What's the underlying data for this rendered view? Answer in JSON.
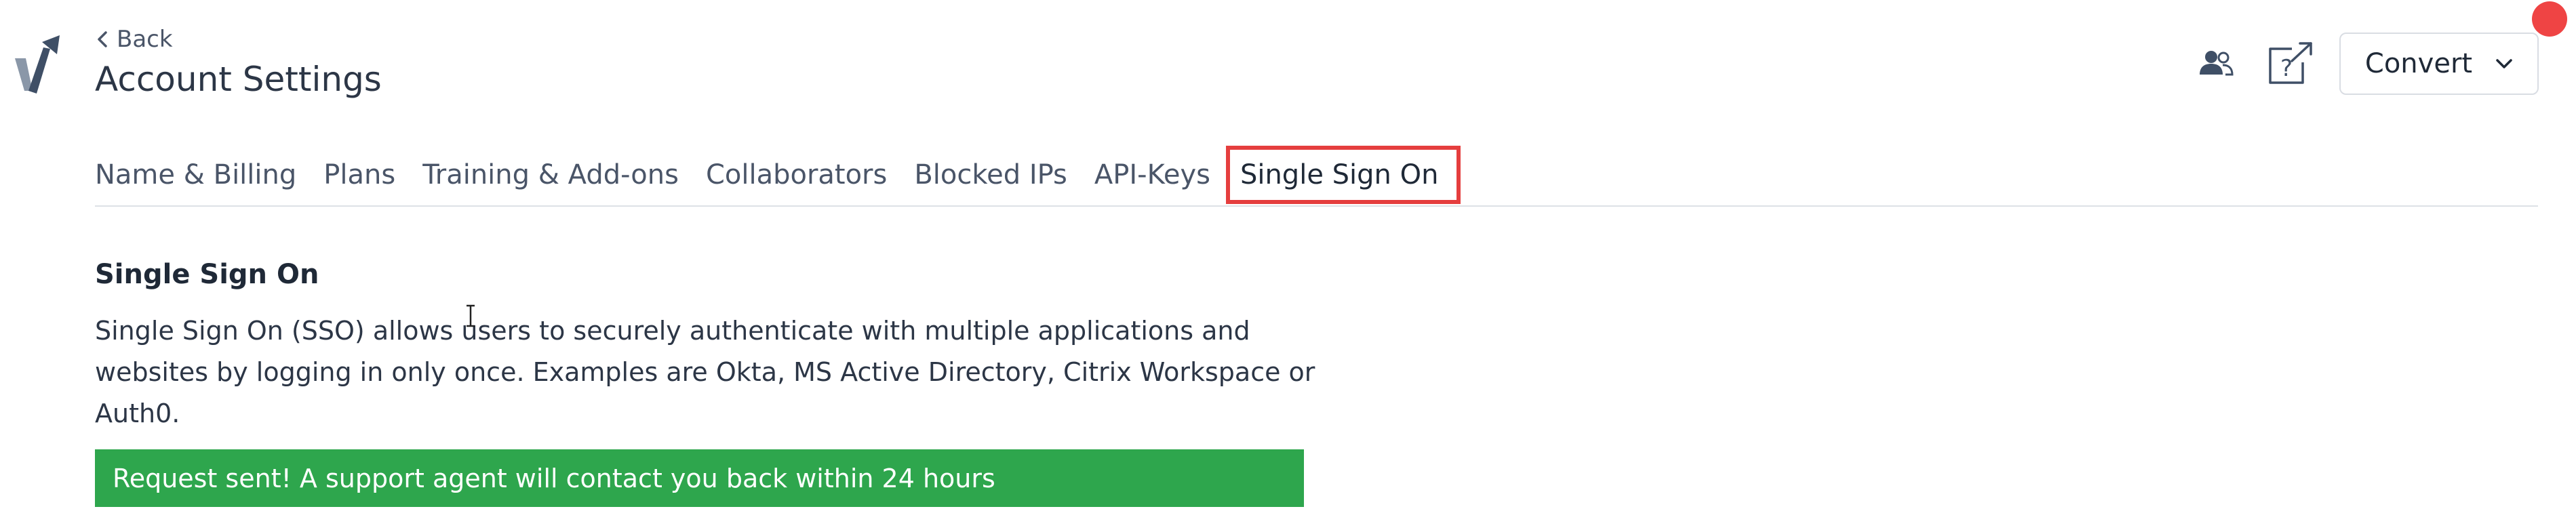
{
  "header": {
    "back_label": "Back",
    "title": "Account Settings"
  },
  "actions": {
    "users_icon": "users-icon",
    "help_icon": "help-external-icon",
    "convert_label": "Convert",
    "notification_color": "#ef4444"
  },
  "tabs": [
    {
      "label": "Name & Billing",
      "active": false
    },
    {
      "label": "Plans",
      "active": false
    },
    {
      "label": "Training & Add-ons",
      "active": false
    },
    {
      "label": "Collaborators",
      "active": false
    },
    {
      "label": "Blocked IPs",
      "active": false
    },
    {
      "label": "API-Keys",
      "active": false
    },
    {
      "label": "Single Sign On",
      "active": true
    }
  ],
  "content": {
    "section_title": "Single Sign On",
    "description": "Single Sign On (SSO) allows users to securely authenticate with multiple applications and websites by logging in only once. Examples are Okta, MS Active Directory, Citrix Workspace or Auth0.",
    "success_message": "Request sent! A support agent will contact you back within 24 hours"
  },
  "colors": {
    "highlight_outline": "#e53e3e",
    "success_banner": "#2ea64d",
    "text": "#2c3646"
  }
}
